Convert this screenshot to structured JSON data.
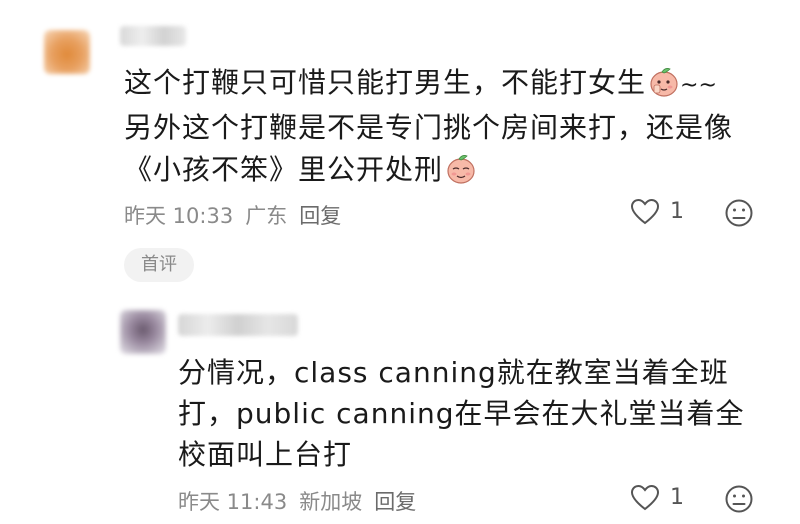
{
  "comment": {
    "lines": [
      "这个打鞭只可惜只能打男生，不能打女生",
      "另外这个打鞭是不是专门挑个房间来打，还是像",
      "《小孩不笨》里公开处刑"
    ],
    "tilde": "~~",
    "emoji_name": "peach-face-emoji",
    "time": "昨天 10:33",
    "location": "广东",
    "reply_label": "回复",
    "like_count": "1",
    "badge": "首评"
  },
  "reply": {
    "lines": [
      "分情况，class canning就在教室当着全班",
      "打，public canning在早会在大礼堂当着全",
      "校面叫上台打"
    ],
    "time": "昨天 11:43",
    "location": "新加坡",
    "reply_label": "回复",
    "like_count": "1"
  },
  "colors": {
    "text": "#1a1a1a",
    "meta": "#8a8a8a",
    "badge_bg": "#f2f2f2",
    "emoji_peach": "#f6b6a6"
  }
}
